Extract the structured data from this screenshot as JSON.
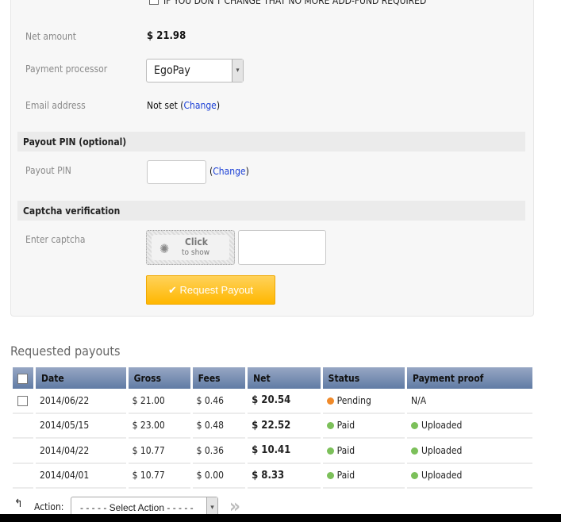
{
  "form": {
    "notice": "IF YOU DON'T CHANGE THAT NO MORE ADD-FUND REQUIRED",
    "net_amount_label": "Net amount",
    "net_amount": "$ 21.98",
    "processor_label": "Payment processor",
    "processor_value": "EgoPay",
    "email_label": "Email address",
    "email_value": "Not set",
    "change": "Change",
    "pin_section": "Payout PIN (optional)",
    "pin_label": "Payout PIN",
    "captcha_section": "Captcha verification",
    "captcha_label": "Enter captcha",
    "captcha_click": "Click",
    "captcha_show": "to show",
    "submit": "Request Payout"
  },
  "payouts": {
    "title": "Requested payouts",
    "columns": [
      "Date",
      "Gross",
      "Fees",
      "Net",
      "Status",
      "Payment proof"
    ],
    "rows": [
      {
        "date": "2014/06/22",
        "gross": "$ 21.00",
        "fees": "$ 0.46",
        "net": "$ 20.54",
        "status": "Pending",
        "proof": "N/A"
      },
      {
        "date": "2014/05/15",
        "gross": "$ 23.00",
        "fees": "$ 0.48",
        "net": "$ 22.52",
        "status": "Paid",
        "proof": "Uploaded"
      },
      {
        "date": "2014/04/22",
        "gross": "$ 10.77",
        "fees": "$ 0.36",
        "net": "$ 10.41",
        "status": "Paid",
        "proof": "Uploaded"
      },
      {
        "date": "2014/04/01",
        "gross": "$ 10.77",
        "fees": "$ 0.00",
        "net": "$ 8.33",
        "status": "Paid",
        "proof": "Uploaded"
      }
    ],
    "action_label": "Action:",
    "action_select": "- - - - - Select Action - - - - -"
  },
  "colors": {
    "pending": "#f08a2a",
    "paid": "#7cc05a",
    "button": "#ffc21a",
    "link": "#1a3fd6"
  }
}
